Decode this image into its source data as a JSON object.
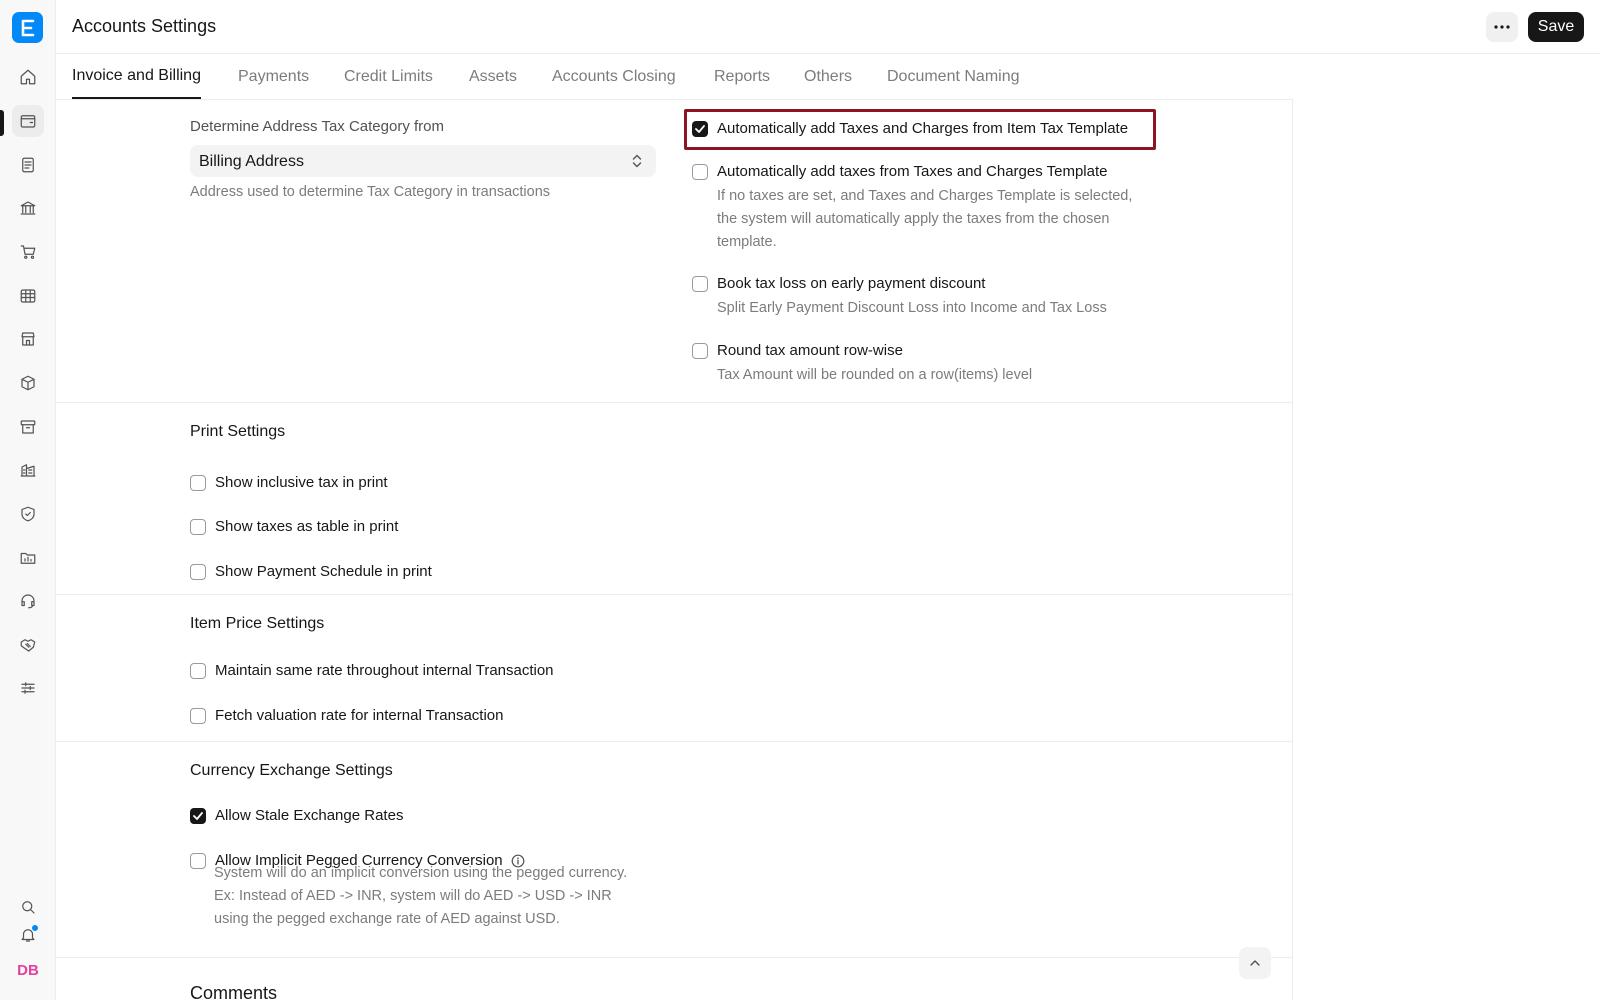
{
  "app": {
    "logo_letter": "E"
  },
  "sidebar": {
    "items": [
      {
        "icon": "home-icon"
      },
      {
        "icon": "wallet-icon"
      },
      {
        "icon": "document-icon"
      },
      {
        "icon": "bank-icon"
      },
      {
        "icon": "cart-icon"
      },
      {
        "icon": "table-icon"
      },
      {
        "icon": "store-icon"
      },
      {
        "icon": "package-icon"
      },
      {
        "icon": "archive-icon"
      },
      {
        "icon": "building-icon"
      },
      {
        "icon": "shield-icon"
      },
      {
        "icon": "folder-chart-icon"
      },
      {
        "icon": "headset-icon"
      },
      {
        "icon": "handshake-icon"
      },
      {
        "icon": "sliders-icon"
      }
    ],
    "bottom": {
      "search_icon": "search-icon",
      "bell_icon": "bell-icon",
      "avatar_initials": "DB"
    }
  },
  "header": {
    "title": "Accounts Settings",
    "more_icon": "ellipsis-icon",
    "save_label": "Save"
  },
  "tabs": [
    {
      "label": "Invoice and Billing",
      "active": true
    },
    {
      "label": "Payments",
      "active": false
    },
    {
      "label": "Credit Limits",
      "active": false
    },
    {
      "label": "Assets",
      "active": false
    },
    {
      "label": "Accounts Closing",
      "active": false
    },
    {
      "label": "Reports",
      "active": false
    },
    {
      "label": "Others",
      "active": false
    },
    {
      "label": "Document Naming",
      "active": false
    }
  ],
  "tax_section": {
    "address_label": "Determine Address Tax Category from",
    "address_value": "Billing Address",
    "address_help": "Address used to determine Tax Category in transactions",
    "checks": [
      {
        "label": "Automatically add Taxes and Charges from Item Tax Template",
        "checked": true,
        "highlighted": true
      },
      {
        "label": "Automatically add taxes from Taxes and Charges Template",
        "checked": false,
        "help": [
          "If no taxes are set, and Taxes and Charges Template is selected,",
          "the system will automatically apply the taxes from the chosen",
          "template."
        ]
      },
      {
        "label": "Book tax loss on early payment discount",
        "checked": false,
        "help": [
          "Split Early Payment Discount Loss into Income and Tax Loss"
        ]
      },
      {
        "label": "Round tax amount row-wise",
        "checked": false,
        "help": [
          "Tax Amount will be rounded on a row(items) level"
        ]
      }
    ]
  },
  "print_settings": {
    "title": "Print Settings",
    "checks": [
      {
        "label": "Show inclusive tax in print",
        "checked": false
      },
      {
        "label": "Show taxes as table in print",
        "checked": false
      },
      {
        "label": "Show Payment Schedule in print",
        "checked": false
      }
    ]
  },
  "item_price_settings": {
    "title": "Item Price Settings",
    "checks": [
      {
        "label": "Maintain same rate throughout internal Transaction",
        "checked": false
      },
      {
        "label": "Fetch valuation rate for internal Transaction",
        "checked": false
      }
    ]
  },
  "currency_settings": {
    "title": "Currency Exchange Settings",
    "checks": [
      {
        "label": "Allow Stale Exchange Rates",
        "checked": true
      },
      {
        "label": "Allow Implicit Pegged Currency Conversion",
        "checked": false,
        "help": [
          "System will do an implicit conversion using the pegged currency.",
          "Ex: Instead of AED -> INR, system will do AED -> USD -> INR",
          "using the pegged exchange rate of AED against USD."
        ]
      }
    ]
  },
  "comments": {
    "title": "Comments"
  }
}
